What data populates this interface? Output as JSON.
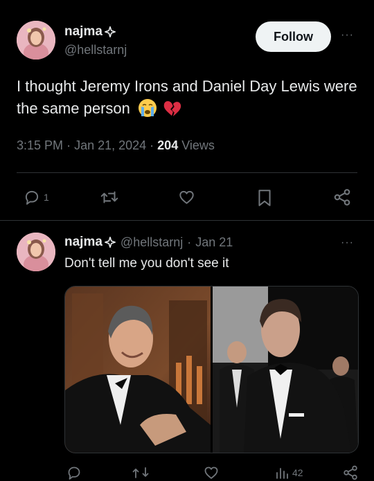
{
  "tweet": {
    "author_name": "najma",
    "author_handle": "@hellstarnj",
    "follow_label": "Follow",
    "more_label": "···",
    "text": "I thought Jeremy Irons and Daniel Day Lewis were the same person",
    "time": "3:15 PM",
    "date": "Jan 21, 2024",
    "views_count": "204",
    "views_label": "Views",
    "reply_count": "1"
  },
  "reply": {
    "author_name": "najma",
    "author_handle": "@hellstarnj",
    "separator": "·",
    "date": "Jan 21",
    "more_label": "···",
    "text": "Don't tell me you don't see it",
    "retweet_count": "",
    "views_count": "42"
  },
  "colors": {
    "background": "#000000",
    "text_primary": "#e7e9ea",
    "text_secondary": "#71767b",
    "divider": "#2f3336",
    "follow_bg": "#eff3f4"
  },
  "icons": [
    "sparkle-icon",
    "crying-face-emoji",
    "broken-heart-emoji",
    "reply-icon",
    "retweet-icon",
    "like-icon",
    "bookmark-icon",
    "share-icon",
    "views-icon"
  ]
}
